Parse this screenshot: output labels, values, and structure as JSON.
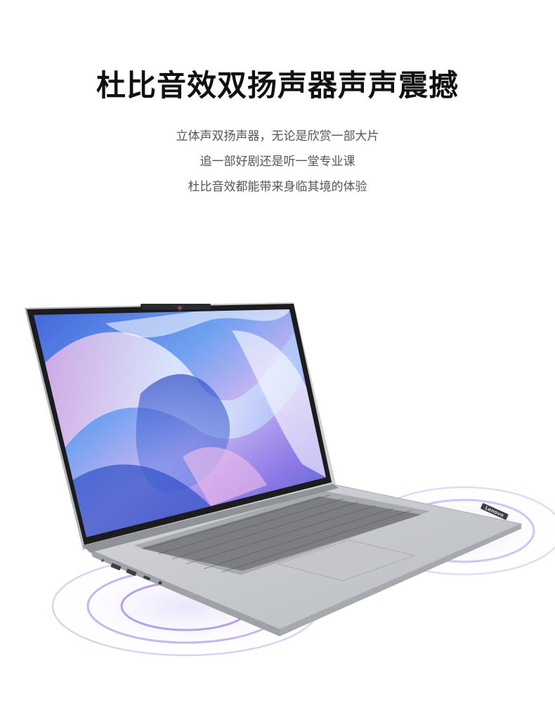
{
  "heading": {
    "title": "杜比音效双扬声器声声震撼"
  },
  "description": {
    "lines": [
      "立体声双扬声器，无论是欣赏一部大片",
      "追一部好剧还是听一堂专业课",
      "杜比音效都能带来身临其境的体验"
    ]
  },
  "product": {
    "brand": "Lenovo",
    "colors": {
      "body": "#c9cbcf",
      "bezel": "#1c1c1e",
      "sound_wave": "#b8a6e8"
    }
  }
}
